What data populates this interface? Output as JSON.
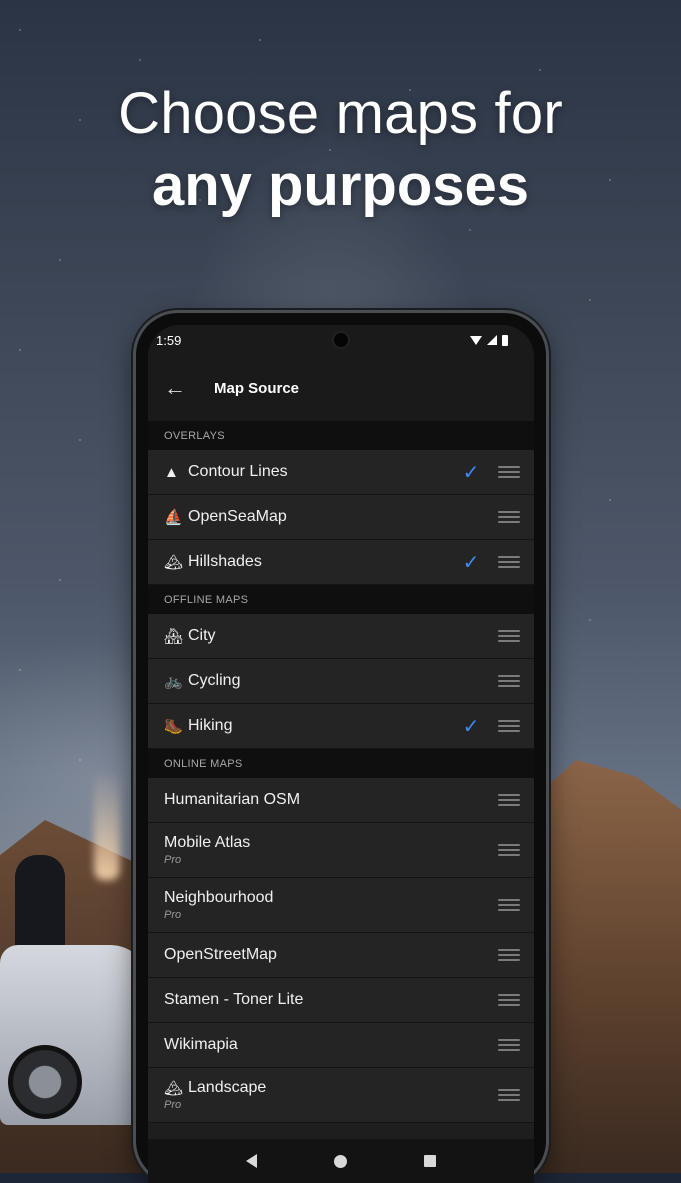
{
  "headline": {
    "line1": "Choose maps for",
    "line2": "any purposes"
  },
  "status": {
    "time": "1:59"
  },
  "appbar": {
    "title": "Map Source",
    "back_icon": "arrow-left-icon"
  },
  "sections": {
    "overlays": "OVERLAYS",
    "offline": "OFFLINE MAPS",
    "online": "ONLINE MAPS"
  },
  "overlays": [
    {
      "label": "Contour Lines",
      "icon": "▲",
      "checked": true
    },
    {
      "label": "OpenSeaMap",
      "icon": "⛵",
      "checked": false
    },
    {
      "label": "Hillshades",
      "icon": "🏔",
      "checked": true
    }
  ],
  "offline": [
    {
      "label": "City",
      "icon": "🏘",
      "checked": false
    },
    {
      "label": "Cycling",
      "icon": "🚲",
      "checked": false
    },
    {
      "label": "Hiking",
      "icon": "🥾",
      "checked": true
    }
  ],
  "online": [
    {
      "label": "Humanitarian OSM",
      "sub": ""
    },
    {
      "label": "Mobile Atlas",
      "sub": "Pro"
    },
    {
      "label": "Neighbourhood",
      "sub": "Pro"
    },
    {
      "label": "OpenStreetMap",
      "sub": ""
    },
    {
      "label": "Stamen - Toner Lite",
      "sub": ""
    },
    {
      "label": "Wikimapia",
      "sub": ""
    },
    {
      "label": "Landscape",
      "sub": "Pro",
      "icon": "🏔"
    }
  ],
  "colors": {
    "accent": "#3d8bf0",
    "row_bg": "#242424",
    "section_bg": "#0f0f0f"
  }
}
